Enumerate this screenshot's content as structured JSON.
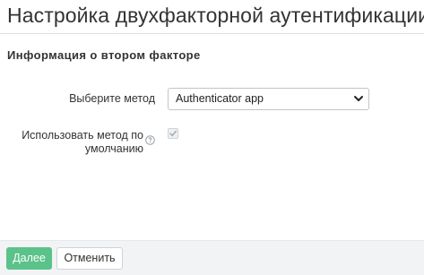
{
  "header": {
    "title": "Настройка двухфакторной аутентификации"
  },
  "section": {
    "title": "Информация о втором факторе"
  },
  "form": {
    "method_label": "Выберите метод",
    "method_value": "Authenticator app",
    "default_label": "Использовать метод по умолчанию",
    "default_checked": true,
    "default_disabled": true,
    "help_icon": "question-circle-icon"
  },
  "footer": {
    "next_label": "Далее",
    "cancel_label": "Отменить",
    "next_color": "#5bc28a"
  }
}
